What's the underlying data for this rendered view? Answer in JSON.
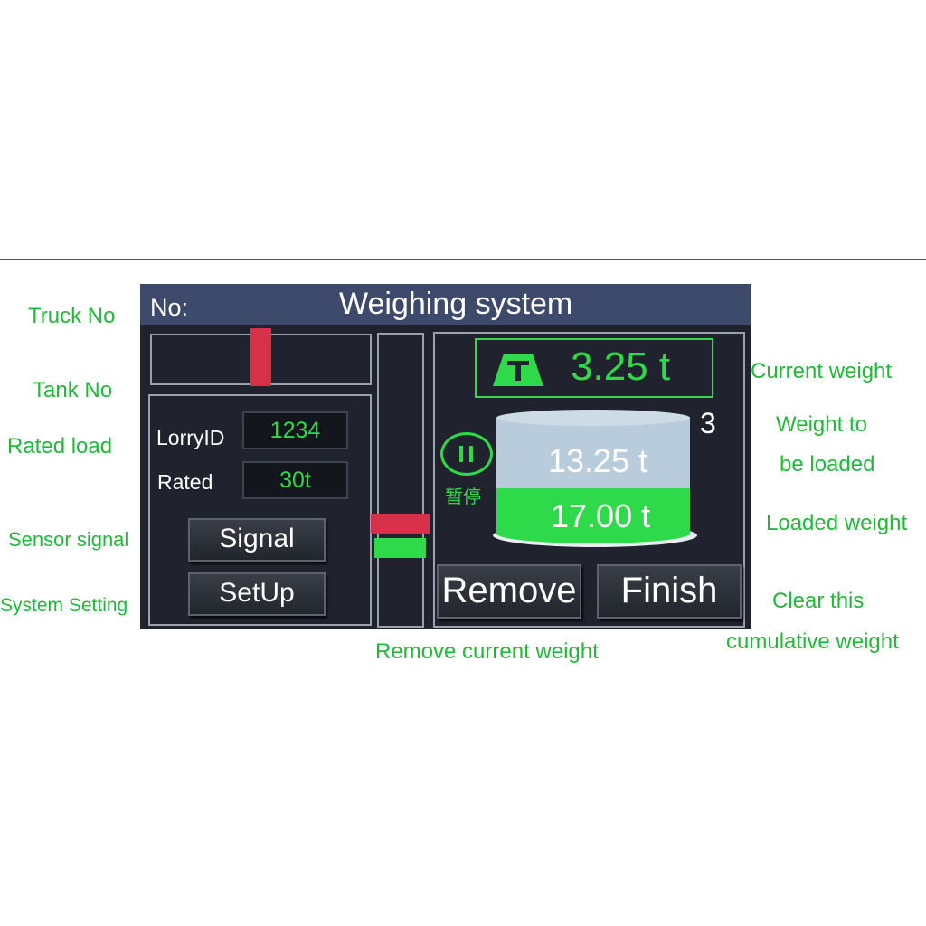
{
  "annotations": {
    "truck_no": "Truck No",
    "tank_no": "Tank No",
    "rated_load": "Rated load",
    "sensor_signal": "Sensor signal",
    "system_setting": "System Setting",
    "remove_current_weight": "Remove current weight",
    "current_weight": "Current weight",
    "weight_to_be_loaded_line1": "Weight to",
    "weight_to_be_loaded_line2": "be loaded",
    "loaded_weight": "Loaded weight",
    "clear_line1": "Clear this",
    "clear_line2": "cumulative weight"
  },
  "header": {
    "no_label": "No:",
    "title": "Weighing system"
  },
  "form": {
    "lorry_id_label": "LorryID",
    "lorry_id_value": "1234",
    "rated_label": "Rated",
    "rated_value": "30t"
  },
  "buttons": {
    "signal": "Signal",
    "setup": "SetUp",
    "remove": "Remove",
    "finish": "Finish"
  },
  "status": {
    "current_weight": "3.25  t",
    "tank_count": "3",
    "to_be_loaded": "13.25  t",
    "loaded": "17.00  t",
    "pause_label": "暂停"
  },
  "icons": {
    "scale": "scale-weight-icon",
    "pause": "pause-icon"
  },
  "colors": {
    "accent_green": "#2ed94a",
    "indicator_red": "#d9304a",
    "annotation_green": "#22b83a",
    "header_blue": "#3d4a6b",
    "screen_bg": "#20232e",
    "cylinder_top": "#b8ccdc"
  }
}
